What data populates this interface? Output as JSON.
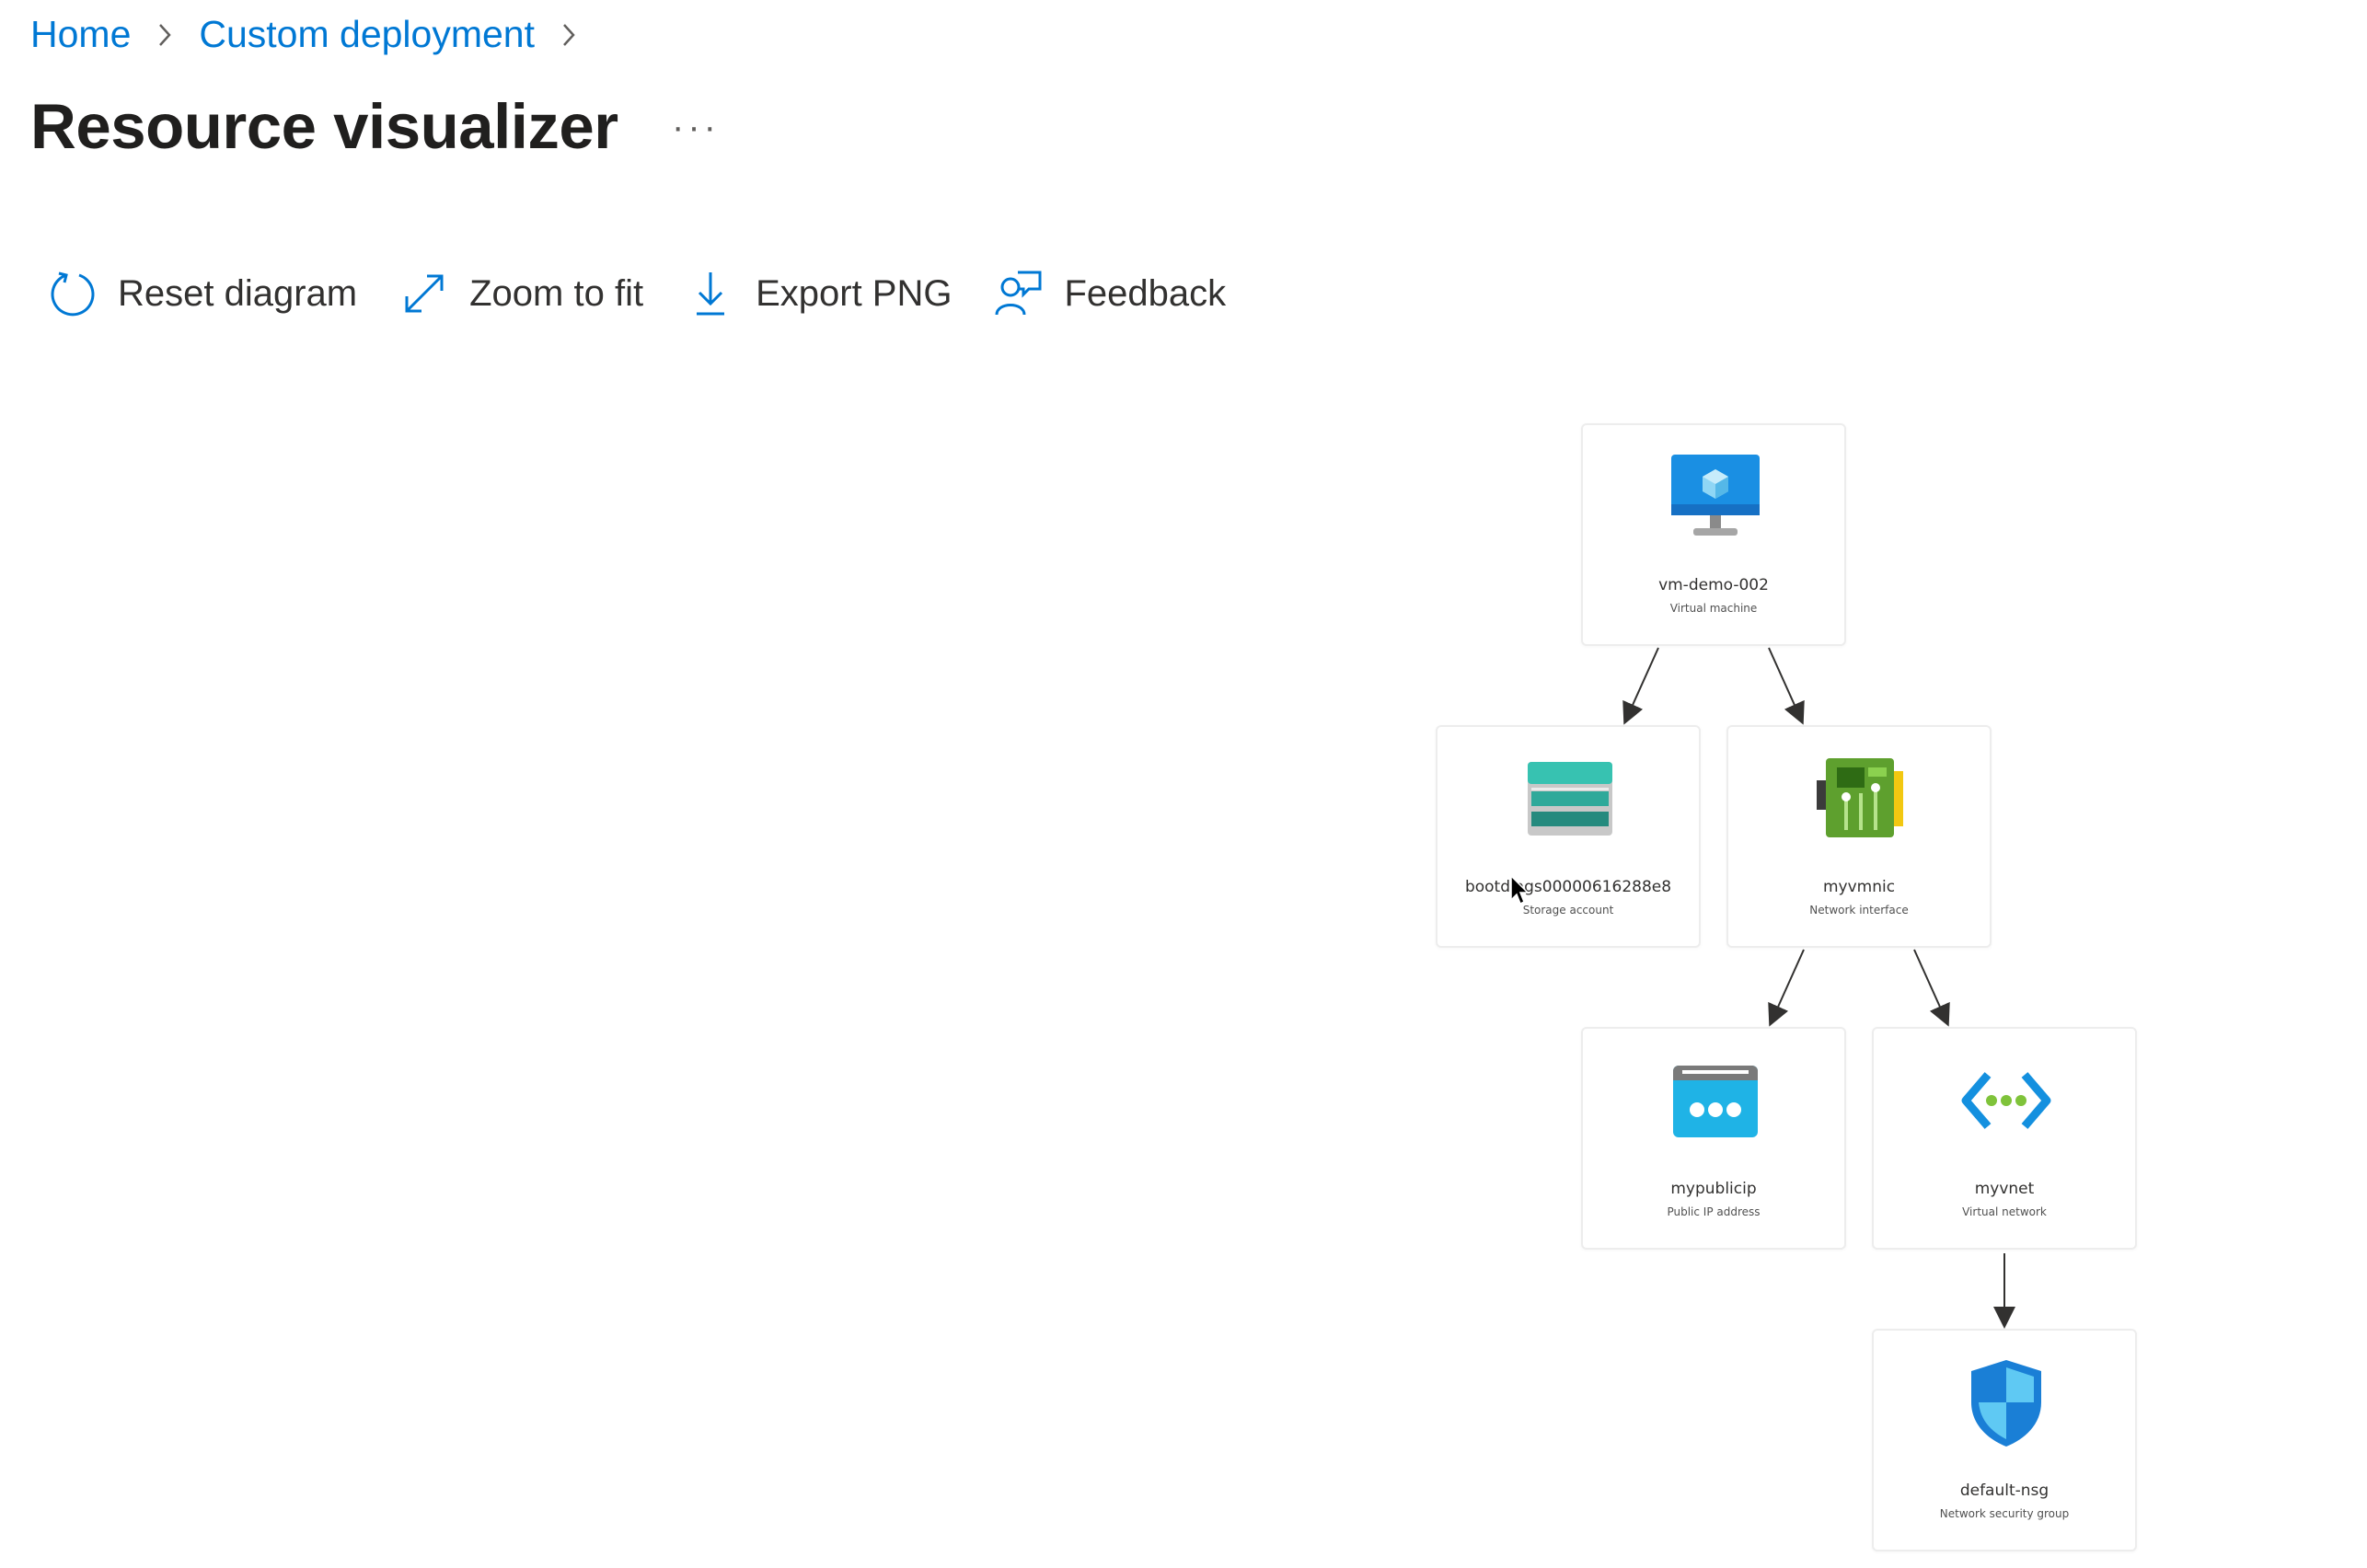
{
  "breadcrumb": {
    "home": "Home",
    "custom_deployment": "Custom deployment"
  },
  "page": {
    "title": "Resource visualizer",
    "more": "···"
  },
  "toolbar": {
    "reset": "Reset diagram",
    "zoom": "Zoom to fit",
    "export": "Export PNG",
    "feedback": "Feedback"
  },
  "nodes": {
    "vm": {
      "name": "vm-demo-002",
      "type": "Virtual machine",
      "icon": "virtual-machine-icon"
    },
    "storage": {
      "name": "bootdiags00000616288e8",
      "type": "Storage account",
      "icon": "storage-account-icon"
    },
    "nic": {
      "name": "myvmnic",
      "type": "Network interface",
      "icon": "network-interface-icon"
    },
    "pip": {
      "name": "mypublicip",
      "type": "Public IP address",
      "icon": "public-ip-icon"
    },
    "vnet": {
      "name": "myvnet",
      "type": "Virtual network",
      "icon": "virtual-network-icon"
    },
    "nsg": {
      "name": "default-nsg",
      "type": "Network security group",
      "icon": "nsg-shield-icon"
    }
  },
  "colors": {
    "link": "#0078d4",
    "text": "#323130",
    "node_border": "#ededed"
  }
}
